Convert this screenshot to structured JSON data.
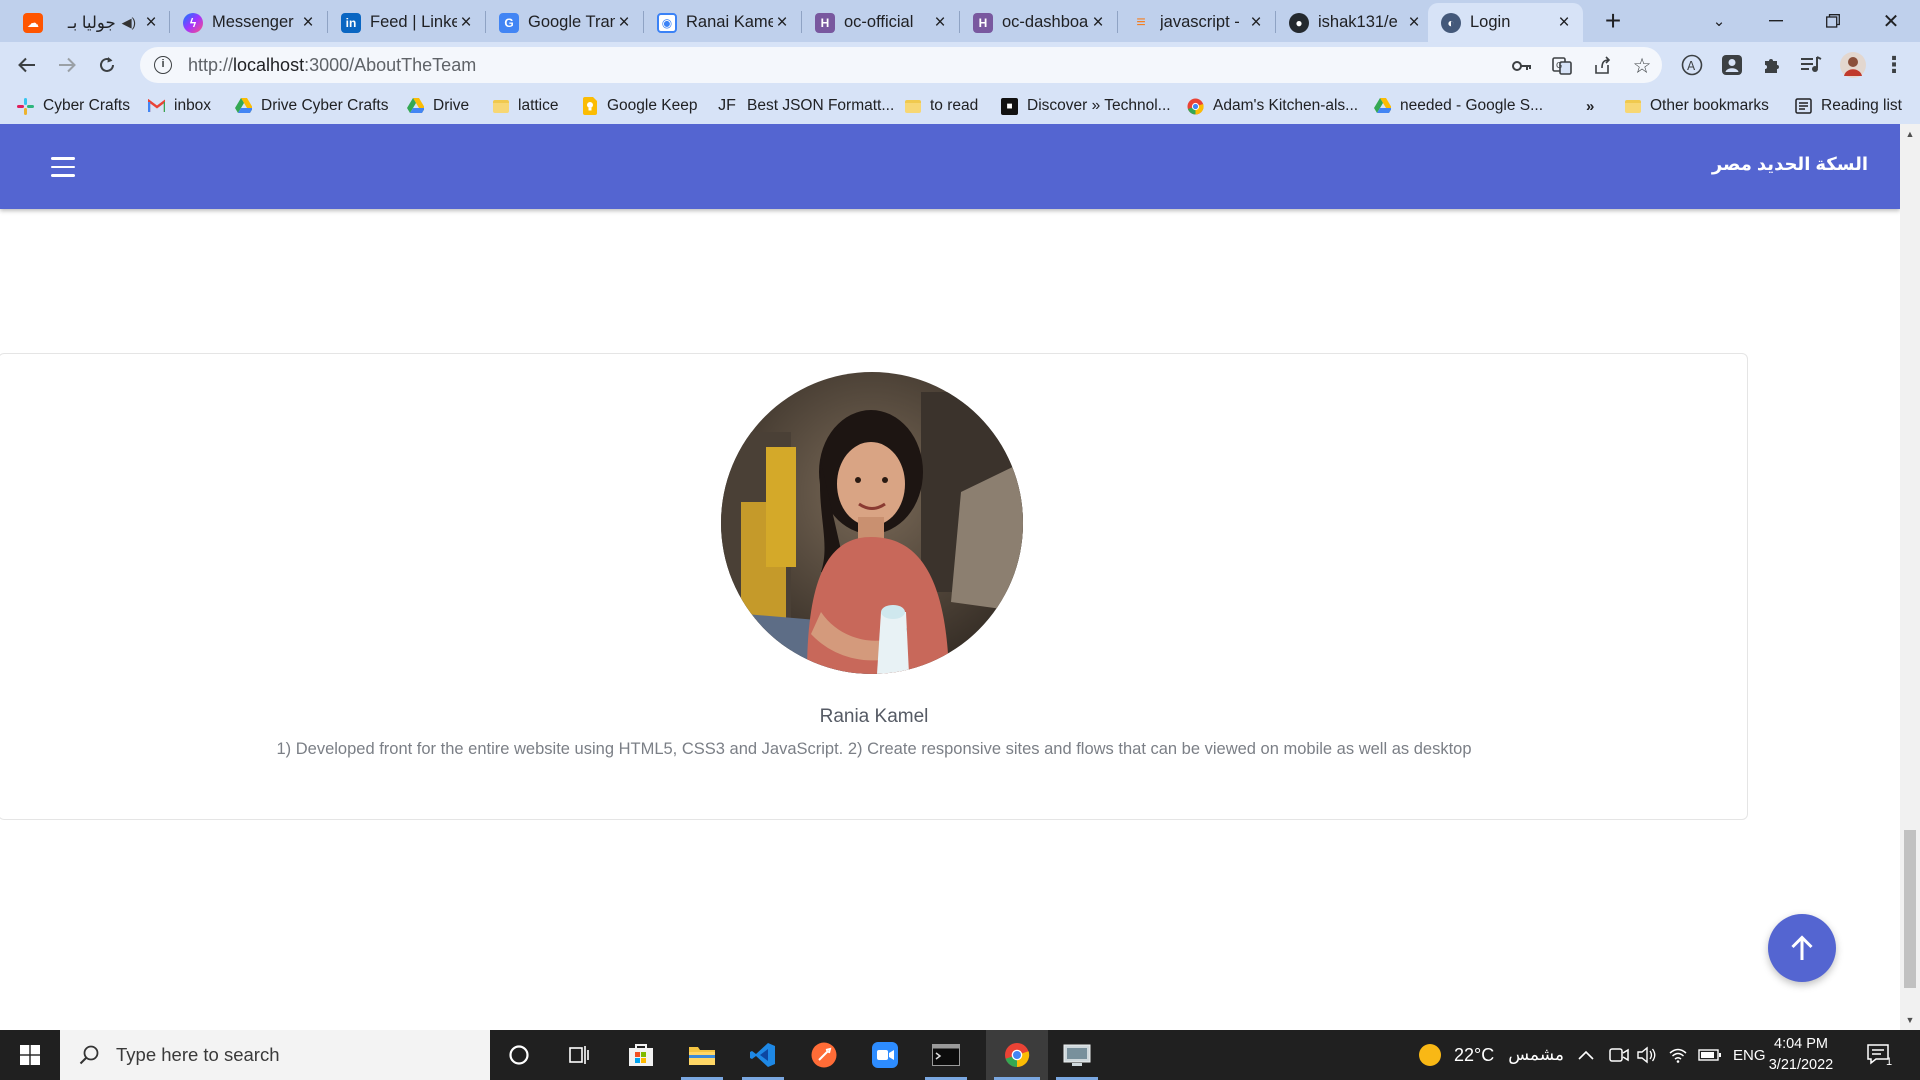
{
  "browser": {
    "tabs": [
      {
        "title": "جوليا بـ",
        "icon": "soundcloud-icon",
        "color": "#ff5500",
        "audio": true
      },
      {
        "title": "Messenger",
        "icon": "messenger-icon",
        "color": "#8a4fff"
      },
      {
        "title": "Feed | LinkedIn",
        "icon": "linkedin-icon",
        "color": "#0a66c2"
      },
      {
        "title": "Google Translate",
        "icon": "google-translate-icon",
        "color": "#4285f4"
      },
      {
        "title": "Ranai Kamel",
        "icon": "camera-icon",
        "color": "#3b82f6"
      },
      {
        "title": "oc-official",
        "icon": "heroku-icon",
        "color": "#79589f"
      },
      {
        "title": "oc-dashboard",
        "icon": "heroku-icon",
        "color": "#79589f"
      },
      {
        "title": "javascript -",
        "icon": "stackoverflow-icon",
        "color": "#f48024"
      },
      {
        "title": "ishak131/e",
        "icon": "github-icon",
        "color": "#24292e"
      },
      {
        "title": "Login",
        "icon": "app-logo-icon",
        "color": "#44597a",
        "active": true
      }
    ],
    "url_prefix": "http://",
    "url_host": "localhost",
    "url_path": ":3000/AboutTheTeam",
    "bookmarks": [
      {
        "label": "Cyber Crafts",
        "icon": "slack-icon"
      },
      {
        "label": "inbox",
        "icon": "gmail-icon"
      },
      {
        "label": "Drive Cyber Crafts",
        "icon": "google-drive-icon"
      },
      {
        "label": "Drive",
        "icon": "google-drive-icon"
      },
      {
        "label": "lattice",
        "icon": "folder-icon"
      },
      {
        "label": "Google Keep",
        "icon": "google-keep-icon"
      },
      {
        "label": "Best JSON Formatt...",
        "icon": "jf-icon"
      },
      {
        "label": "to read",
        "icon": "folder-icon"
      },
      {
        "label": "Discover » Technol...",
        "icon": "discover-icon"
      },
      {
        "label": "Adam's Kitchen-als...",
        "icon": "chrome-icon"
      },
      {
        "label": "needed - Google S...",
        "icon": "google-drive-icon"
      }
    ],
    "bookmarks_overflow": "»",
    "other_bookmarks": "Other bookmarks",
    "reading_list": "Reading list"
  },
  "page": {
    "brand": "السكة الحديد مصر",
    "member": {
      "name": "Rania Kamel",
      "description": "1) Developed front for the entire website using HTML5, CSS3 and JavaScript. 2) Create responsive sites and flows that can be viewed on mobile as well as desktop"
    },
    "accent_color": "#5465d1"
  },
  "taskbar": {
    "search_placeholder": "Type here to search",
    "weather_temp": "22°C",
    "weather_text": "مشمس",
    "language": "ENG",
    "time": "4:04 PM",
    "date": "3/21/2022",
    "notification_count": "1"
  }
}
